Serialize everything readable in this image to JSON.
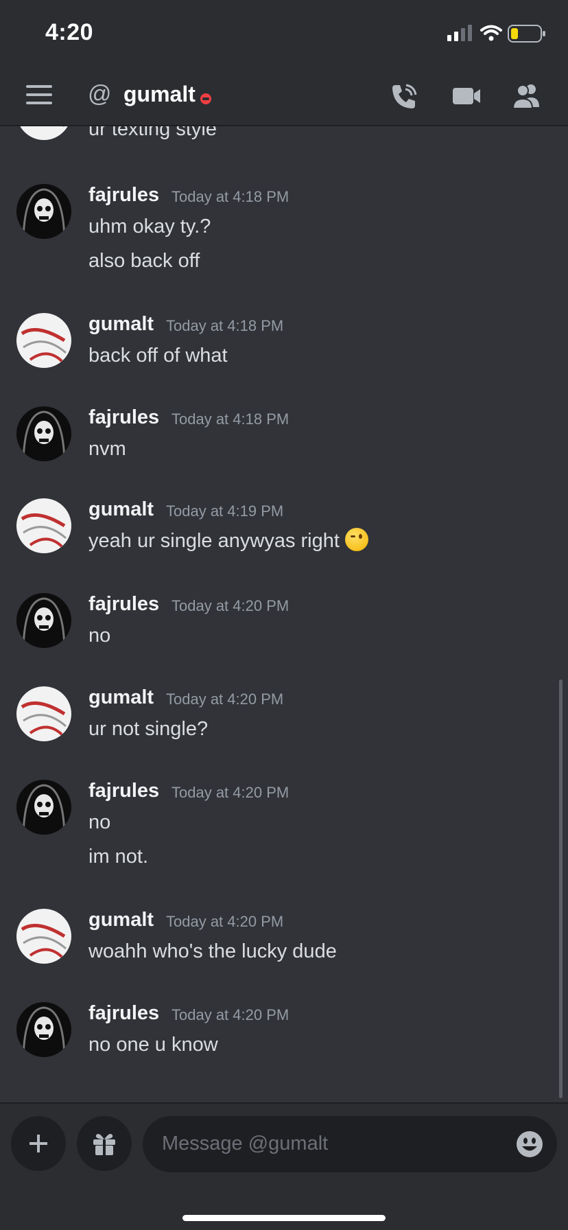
{
  "status_bar": {
    "time": "4:20"
  },
  "header": {
    "at_symbol": "@",
    "channel_name": "gumalt"
  },
  "messages": [
    {
      "author": "",
      "time": "",
      "lines": [
        "ur texting style"
      ],
      "partial": true
    },
    {
      "author": "fajrules",
      "time": "Today at 4:18 PM",
      "lines": [
        "uhm okay ty.?",
        "also back off"
      ]
    },
    {
      "author": "gumalt",
      "time": "Today at 4:18 PM",
      "lines": [
        "back off of what"
      ]
    },
    {
      "author": "fajrules",
      "time": "Today at 4:18 PM",
      "lines": [
        "nvm"
      ]
    },
    {
      "author": "gumalt",
      "time": "Today at 4:19 PM",
      "lines": [
        "yeah ur single anywyas right"
      ]
    },
    {
      "author": "fajrules",
      "time": "Today at 4:20 PM",
      "lines": [
        "no"
      ]
    },
    {
      "author": "gumalt",
      "time": "Today at 4:20 PM",
      "lines": [
        "ur not single?"
      ]
    },
    {
      "author": "fajrules",
      "time": "Today at 4:20 PM",
      "lines": [
        "no",
        "im not."
      ]
    },
    {
      "author": "gumalt",
      "time": "Today at 4:20 PM",
      "lines": [
        "woahh who's the lucky dude"
      ]
    },
    {
      "author": "fajrules",
      "time": "Today at 4:20 PM",
      "lines": [
        "no one u know"
      ]
    }
  ],
  "composer": {
    "placeholder": "Message @gumalt"
  },
  "colors": {
    "background": "#313338",
    "header": "#2b2d31",
    "dnd": "#f23f43",
    "battery": "#f5d90a"
  }
}
